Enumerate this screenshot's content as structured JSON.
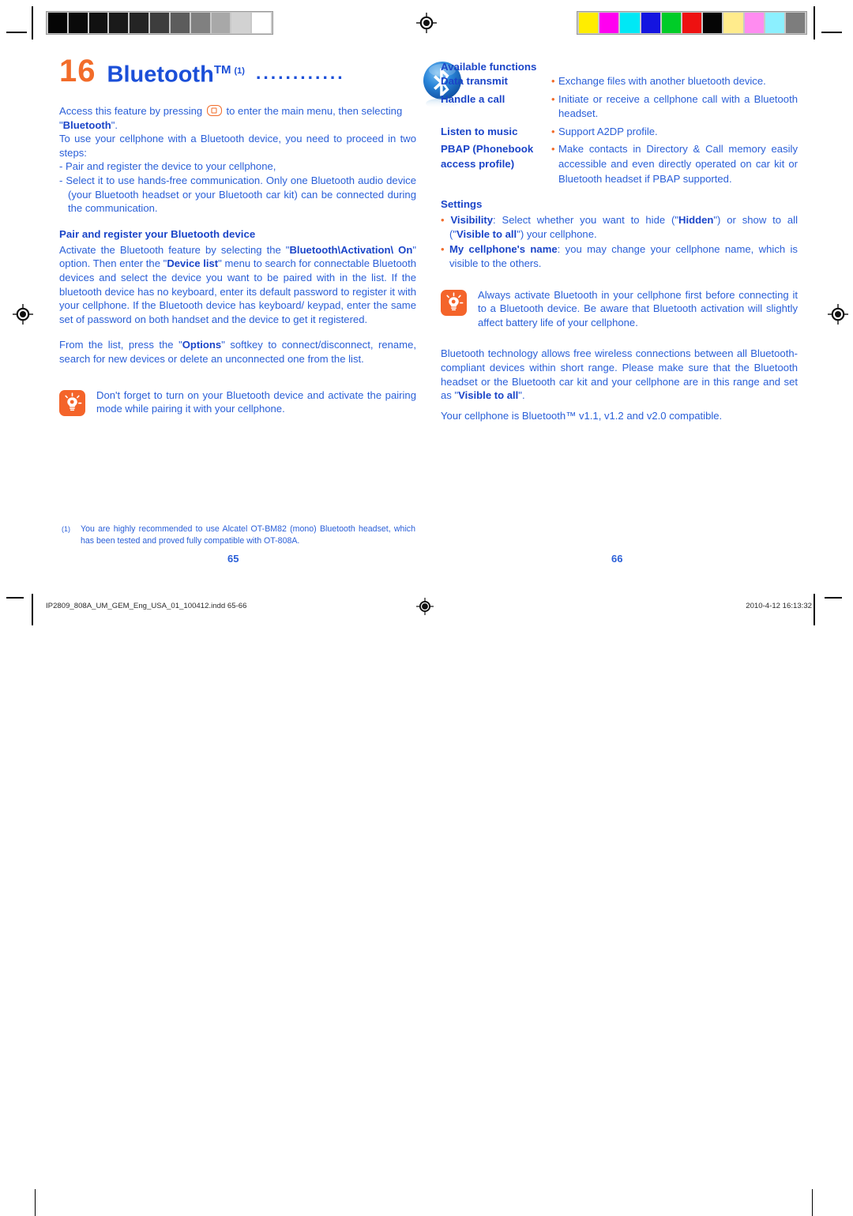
{
  "marks": {
    "grayscale_patches": [
      "#050505",
      "#0a0a0a",
      "#111111",
      "#1a1a1a",
      "#242424",
      "#3d3d3d",
      "#5c5c5c",
      "#808080",
      "#a8a8a8",
      "#d2d2d2",
      "#ffffff"
    ],
    "color_patches": [
      "#ffed00",
      "#ff00f0",
      "#00e8f5",
      "#1414e0",
      "#00cc28",
      "#ee1111",
      "#050505",
      "#ffeb8c",
      "#ff8cf0",
      "#8cf0ff",
      "#7d7d7d"
    ],
    "registration_icon": "registration-target-icon"
  },
  "colors": {
    "heading_blue": "#1b45c8",
    "body_blue": "#2a5fd8",
    "accent_orange": "#f26c2a",
    "bluetooth_blue": "#1f6fd0"
  },
  "left_page": {
    "chapter_number": "16",
    "chapter_title": "Bluetooth",
    "chapter_tm": "TM",
    "chapter_footnote_mark": "(1)",
    "leader_dots": "............",
    "logo_icon": "bluetooth-logo-icon",
    "intro": {
      "line1_a": "Access this feature by pressing ",
      "line1_b": " to enter the main menu, then selecting ",
      "line1_quote_open": "\"",
      "line1_bold": "Bluetooth",
      "line1_quote_close": "\".",
      "key_icon": "ok-key-icon"
    },
    "para_two_steps": "To use your cellphone with a Bluetooth device, you need to proceed in two steps:",
    "step1": "- Pair and register the device to your cellphone,",
    "step2": "- Select it to use hands-free communication. Only one Bluetooth audio device (your Bluetooth headset or your Bluetooth car kit) can be connected during the communication.",
    "subhead_pair": "Pair and register your Bluetooth device",
    "pair_para": {
      "p1": "Activate the Bluetooth feature by selecting the \"",
      "b1": "Bluetooth\\Activation\\ On",
      "p2": "\" option. Then enter the \"",
      "b2": "Device list",
      "p3": "\" menu to search for connectable Bluetooth devices and select the device you want to be paired with in the list. If the bluetooth device has no keyboard, enter its default password to register it with your cellphone. If the Bluetooth device has keyboard/ keypad, enter the same set of password on both handset and the device to get it registered."
    },
    "options_para": {
      "p1": "From the list, press the \"",
      "b1": "Options",
      "p2": "\" softkey to connect/disconnect, rename, search for new devices or delete an unconnected one from the list."
    },
    "tip": {
      "icon": "tip-bulb-icon",
      "text": "Don't forget to turn on your Bluetooth device and activate the pairing mode while pairing it with your cellphone."
    },
    "footnote": {
      "mark": "(1)",
      "text": "You are highly recommended to use Alcatel OT-BM82 (mono) Bluetooth headset, which has been tested and proved fully compatible with OT-808A."
    },
    "page_number": "65"
  },
  "right_page": {
    "available_functions_heading": "Available functions",
    "functions": [
      {
        "label": "Data transmit",
        "bullet": "•",
        "desc": "Exchange files with another bluetooth device."
      },
      {
        "label": "Handle a call",
        "bullet": "•",
        "desc": "Initiate or receive a cellphone call with a Bluetooth headset."
      },
      {
        "label": "Listen to music",
        "bullet": "•",
        "desc": "Support A2DP profile."
      },
      {
        "label": "PBAP (Phonebook access profile)",
        "bullet": "•",
        "desc": "Make contacts in Directory & Call memory easily accessible and even directly operated on car kit or Bluetooth headset if PBAP supported."
      }
    ],
    "settings_heading": "Settings",
    "settings": [
      {
        "bullet": "•",
        "bold": "Visibility",
        "p1": ": Select whether you want to hide (\"",
        "b2": "Hidden",
        "p2": "\") or show to all (\"",
        "b3": "Visible to all",
        "p3": "\") your cellphone."
      },
      {
        "bullet": "•",
        "bold": "My cellphone's name",
        "p1": ": you may change your cellphone name, which is visible to the others.",
        "b2": "",
        "p2": "",
        "b3": "",
        "p3": ""
      }
    ],
    "tip": {
      "icon": "tip-bulb-icon",
      "text": "Always activate Bluetooth in your cellphone first before connecting it to a Bluetooth device. Be aware that Bluetooth activation will slightly affect battery life of your cellphone."
    },
    "tech_para": {
      "p1": "Bluetooth technology allows free wireless connections between all Bluetooth-compliant devices within short range. Please make sure that the Bluetooth headset or the Bluetooth car kit and your cellphone are in this range and set as \"",
      "b1": "Visible to all",
      "p2": "\"."
    },
    "compat_para": "Your cellphone is Bluetooth™ v1.1, v1.2 and v2.0 compatible.",
    "page_number": "66"
  },
  "slug": {
    "filename": "IP2809_808A_UM_GEM_Eng_USA_01_100412.indd   65-66",
    "timestamp": "2010-4-12   16:13:32",
    "center_icon": "registration-target-icon"
  }
}
